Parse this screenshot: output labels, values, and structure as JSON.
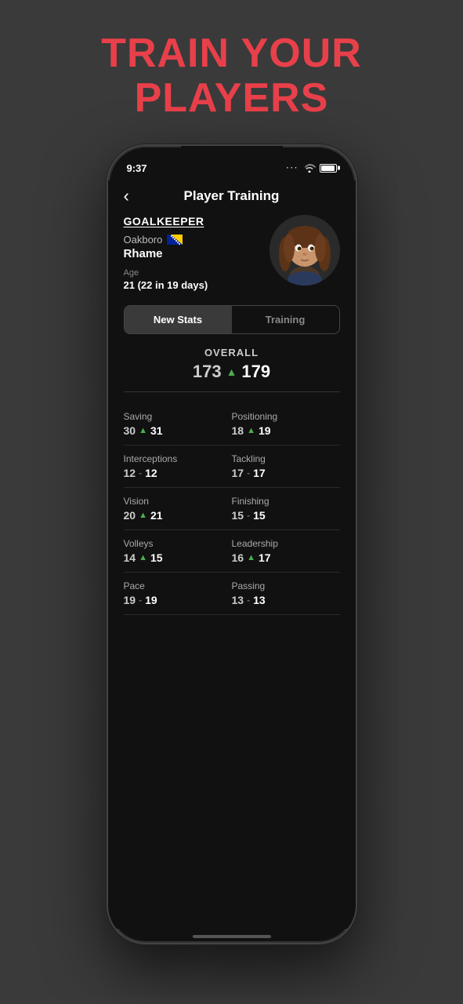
{
  "headline": {
    "line1": "TRAIN YOUR",
    "line2": "PLAYERS"
  },
  "statusBar": {
    "time": "9:37",
    "dotsLabel": "..."
  },
  "navHeader": {
    "backLabel": "‹",
    "title": "Player Training"
  },
  "player": {
    "position": "GOALKEEPER",
    "team": "Oakboro",
    "name": "Rhame",
    "ageLabel": "Age",
    "ageValue": "21 (22 in 19 days)"
  },
  "tabs": {
    "newStats": "New Stats",
    "training": "Training"
  },
  "overall": {
    "label": "OVERALL",
    "oldValue": "173",
    "newValue": "179"
  },
  "stats": [
    {
      "name": "Saving",
      "old": "30",
      "new": "31",
      "changed": true,
      "side": "left"
    },
    {
      "name": "Positioning",
      "old": "18",
      "new": "19",
      "changed": true,
      "side": "right"
    },
    {
      "name": "Interceptions",
      "old": "12",
      "new": "12",
      "changed": false,
      "side": "left"
    },
    {
      "name": "Tackling",
      "old": "17",
      "new": "17",
      "changed": false,
      "side": "right"
    },
    {
      "name": "Vision",
      "old": "20",
      "new": "21",
      "changed": true,
      "side": "left"
    },
    {
      "name": "Finishing",
      "old": "15",
      "new": "15",
      "changed": false,
      "side": "right"
    },
    {
      "name": "Volleys",
      "old": "14",
      "new": "15",
      "changed": true,
      "side": "left"
    },
    {
      "name": "Leadership",
      "old": "16",
      "new": "17",
      "changed": true,
      "side": "right"
    },
    {
      "name": "Pace",
      "old": "19",
      "new": "19",
      "changed": false,
      "side": "left"
    },
    {
      "name": "Passing",
      "old": "13",
      "new": "13",
      "changed": false,
      "side": "right"
    }
  ],
  "colors": {
    "accent": "#e8404a",
    "arrowUp": "#4caf50",
    "background": "#3a3a3a",
    "phoneBg": "#111"
  }
}
